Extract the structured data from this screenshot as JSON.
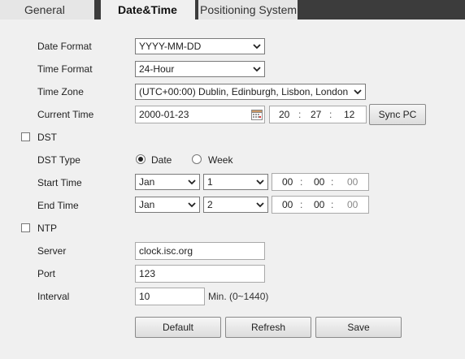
{
  "tabs": [
    "General",
    "Date&Time",
    "Positioning System"
  ],
  "form": {
    "date_format": {
      "label": "Date Format",
      "value": "YYYY-MM-DD"
    },
    "time_format": {
      "label": "Time Format",
      "value": "24-Hour"
    },
    "time_zone": {
      "label": "Time Zone",
      "value": "(UTC+00:00) Dublin, Edinburgh, Lisbon, London"
    },
    "current_time": {
      "label": "Current Time",
      "date": "2000-01-23",
      "hour": "20",
      "minute": "27",
      "second": "12",
      "sync_label": "Sync PC"
    },
    "dst": {
      "label": "DST",
      "checked": false
    },
    "dst_type": {
      "label": "DST Type",
      "option_date": "Date",
      "option_week": "Week",
      "selected": "Date"
    },
    "start_time": {
      "label": "Start Time",
      "month": "Jan",
      "day": "1",
      "hour": "00",
      "minute": "00",
      "second": "00"
    },
    "end_time": {
      "label": "End Time",
      "month": "Jan",
      "day": "2",
      "hour": "00",
      "minute": "00",
      "second": "00"
    },
    "ntp": {
      "label": "NTP",
      "checked": false
    },
    "server": {
      "label": "Server",
      "value": "clock.isc.org"
    },
    "port": {
      "label": "Port",
      "value": "123"
    },
    "interval": {
      "label": "Interval",
      "value": "10",
      "unit": "Min. (0~1440)"
    }
  },
  "buttons": {
    "default": "Default",
    "refresh": "Refresh",
    "save": "Save"
  },
  "colors": {
    "tabbar": "#3c3c3c",
    "page": "#f0f0f0"
  }
}
